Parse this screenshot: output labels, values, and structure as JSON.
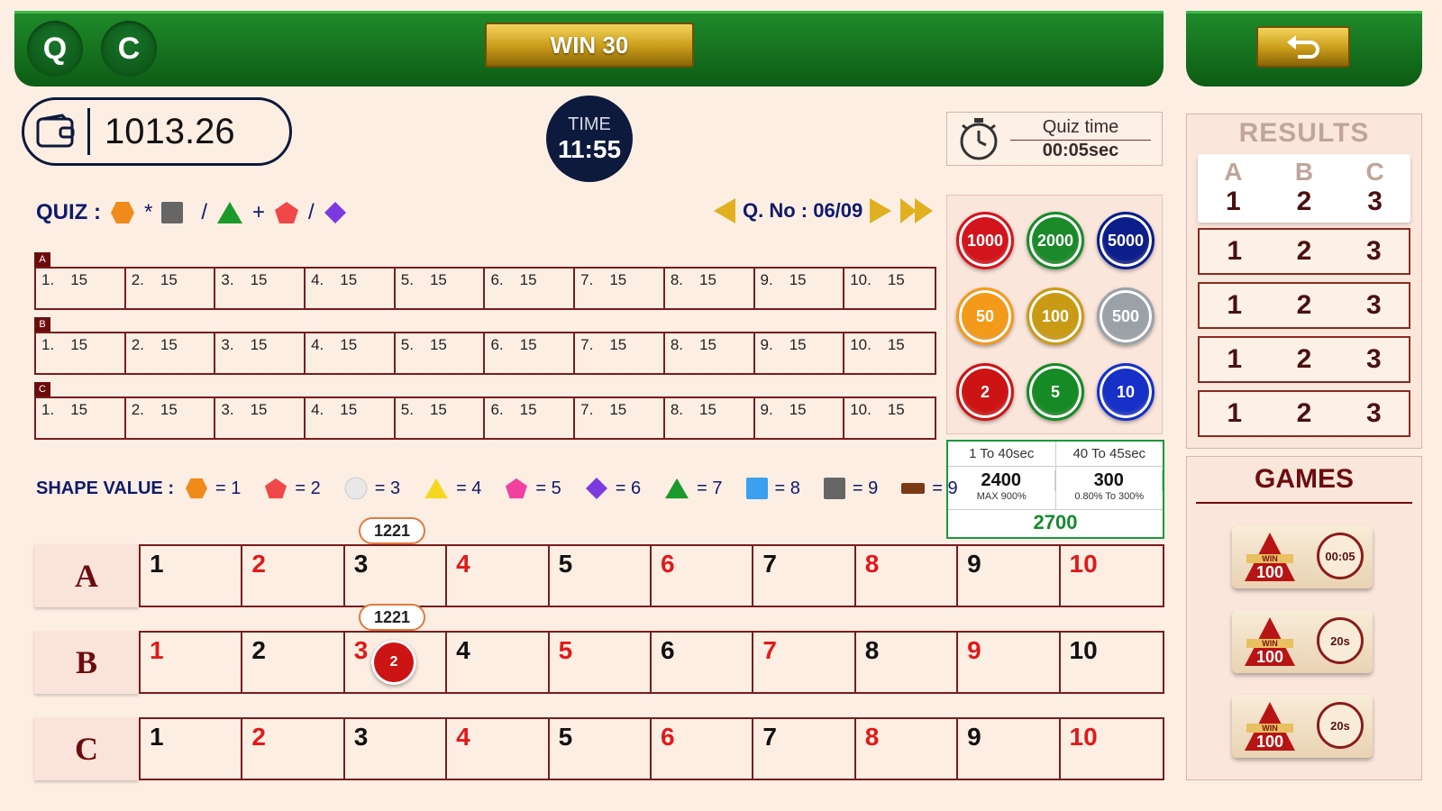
{
  "header": {
    "q_label": "Q",
    "c_label": "C",
    "win_label": "WIN 30",
    "back_icon": "back-arrow-icon"
  },
  "wallet": {
    "icon": "wallet-icon",
    "balance": "1013.26"
  },
  "timer": {
    "label": "TIME",
    "value": "11:55"
  },
  "quiz_time": {
    "icon": "stopwatch-icon",
    "label": "Quiz time",
    "value": "00:05sec"
  },
  "quiz": {
    "label": "QUIZ :"
  },
  "question_nav": {
    "label": "Q. No : 06/09"
  },
  "tickets": {
    "rows": [
      {
        "tag": "A",
        "cells": [
          [
            "1.",
            "15"
          ],
          [
            "2.",
            "15"
          ],
          [
            "3.",
            "15"
          ],
          [
            "4.",
            "15"
          ],
          [
            "5.",
            "15"
          ],
          [
            "6.",
            "15"
          ],
          [
            "7.",
            "15"
          ],
          [
            "8.",
            "15"
          ],
          [
            "9.",
            "15"
          ],
          [
            "10.",
            "15"
          ]
        ]
      },
      {
        "tag": "B",
        "cells": [
          [
            "1.",
            "15"
          ],
          [
            "2.",
            "15"
          ],
          [
            "3.",
            "15"
          ],
          [
            "4.",
            "15"
          ],
          [
            "5.",
            "15"
          ],
          [
            "6.",
            "15"
          ],
          [
            "7.",
            "15"
          ],
          [
            "8.",
            "15"
          ],
          [
            "9.",
            "15"
          ],
          [
            "10.",
            "15"
          ]
        ]
      },
      {
        "tag": "C",
        "cells": [
          [
            "1.",
            "15"
          ],
          [
            "2.",
            "15"
          ],
          [
            "3.",
            "15"
          ],
          [
            "4.",
            "15"
          ],
          [
            "5.",
            "15"
          ],
          [
            "6.",
            "15"
          ],
          [
            "7.",
            "15"
          ],
          [
            "8.",
            "15"
          ],
          [
            "9.",
            "15"
          ],
          [
            "10.",
            "15"
          ]
        ]
      }
    ]
  },
  "chips": [
    {
      "value": "1000",
      "color": "#d4141c"
    },
    {
      "value": "2000",
      "color": "#1a8a2a"
    },
    {
      "value": "5000",
      "color": "#0c1e8a"
    },
    {
      "value": "50",
      "color": "#f39a1a"
    },
    {
      "value": "100",
      "color": "#c99a14"
    },
    {
      "value": "500",
      "color": "#9aa2a8"
    },
    {
      "value": "2",
      "color": "#cc1414"
    },
    {
      "value": "5",
      "color": "#168a24"
    },
    {
      "value": "10",
      "color": "#1630c8"
    }
  ],
  "payout": {
    "col1_head": "1 To 40sec",
    "col2_head": "40 To 45sec",
    "col1_value": "2400",
    "col1_note": "MAX 900%",
    "col2_value": "300",
    "col2_note": "0.80% To 300%",
    "total": "2700"
  },
  "shape_value": {
    "label": "SHAPE VALUE :",
    "items": [
      {
        "shape": "orange-hexagon",
        "text": "= 1"
      },
      {
        "shape": "red-pentagon",
        "text": "= 2"
      },
      {
        "shape": "white-circle",
        "text": "= 3"
      },
      {
        "shape": "yellow-triangle",
        "text": "= 4"
      },
      {
        "shape": "pink-pentagon",
        "text": "= 5"
      },
      {
        "shape": "purple-diamond",
        "text": "= 6"
      },
      {
        "shape": "green-triangle",
        "text": "= 7"
      },
      {
        "shape": "blue-square",
        "text": "= 8"
      },
      {
        "shape": "gray-square",
        "text": "= 9"
      },
      {
        "shape": "brown-bar",
        "text": "= 9"
      }
    ]
  },
  "boards": [
    {
      "label": "A",
      "numbers": [
        "1",
        "2",
        "3",
        "4",
        "5",
        "6",
        "7",
        "8",
        "9",
        "10"
      ],
      "colors": [
        "blk",
        "red",
        "blk",
        "red",
        "blk",
        "red",
        "blk",
        "red",
        "blk",
        "red"
      ]
    },
    {
      "label": "B",
      "numbers": [
        "1",
        "2",
        "3",
        "4",
        "5",
        "6",
        "7",
        "8",
        "9",
        "10"
      ],
      "colors": [
        "red",
        "blk",
        "red",
        "blk",
        "red",
        "blk",
        "red",
        "blk",
        "red",
        "blk"
      ]
    },
    {
      "label": "C",
      "numbers": [
        "1",
        "2",
        "3",
        "4",
        "5",
        "6",
        "7",
        "8",
        "9",
        "10"
      ],
      "colors": [
        "blk",
        "red",
        "blk",
        "red",
        "blk",
        "red",
        "blk",
        "red",
        "blk",
        "red"
      ]
    }
  ],
  "bubbles": {
    "a3": "1221",
    "b3": "1221",
    "b3_chip": "2"
  },
  "results": {
    "title": "RESULTS",
    "header": [
      "A",
      "B",
      "C"
    ],
    "rows": [
      [
        "1",
        "2",
        "3"
      ],
      [
        "1",
        "2",
        "3"
      ],
      [
        "1",
        "2",
        "3"
      ],
      [
        "1",
        "2",
        "3"
      ],
      [
        "1",
        "2",
        "3"
      ]
    ]
  },
  "games": {
    "title": "GAMES",
    "cards": [
      {
        "win_label": "WIN",
        "amount": "100",
        "time": "00:05"
      },
      {
        "win_label": "WIN",
        "amount": "100",
        "time": "20s"
      },
      {
        "win_label": "WIN",
        "amount": "100",
        "time": "20s"
      }
    ]
  }
}
